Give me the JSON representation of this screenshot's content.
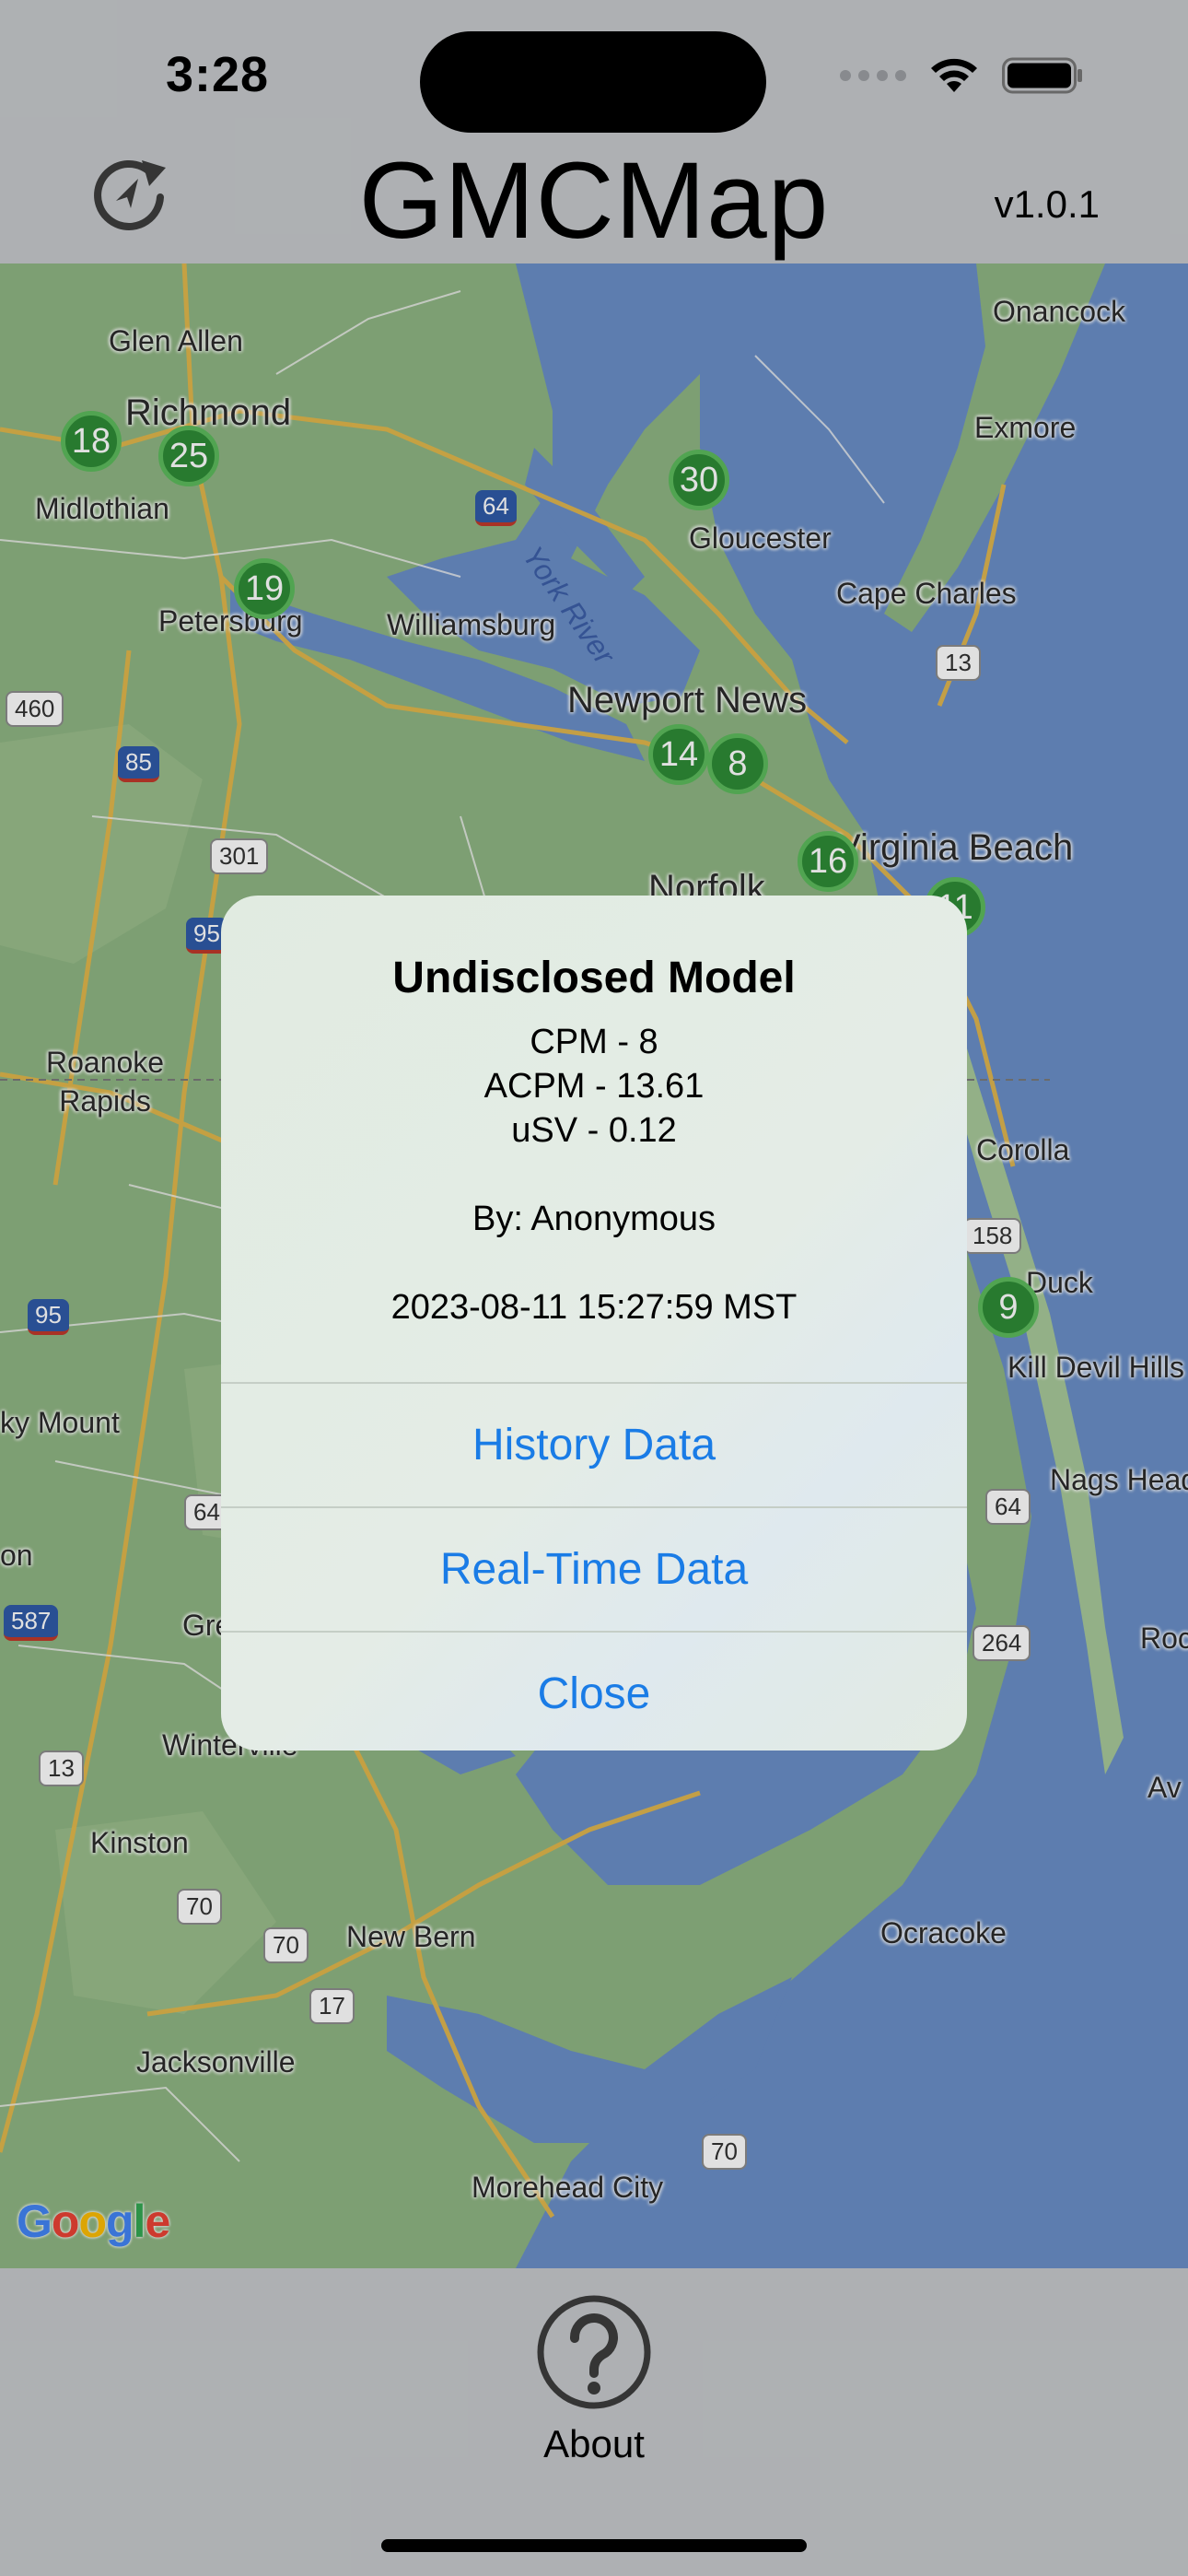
{
  "status_bar": {
    "time": "3:28"
  },
  "header": {
    "title": "GMCMap",
    "version": "v1.0.1",
    "refresh_icon": "refresh-location-icon"
  },
  "map": {
    "attribution": "Google",
    "places": {
      "glen_allen": "Glen Allen",
      "richmond": "Richmond",
      "midlothian": "Midlothian",
      "petersburg": "Petersburg",
      "williamsburg": "Williamsburg",
      "gloucester": "Gloucester",
      "york_river": "York River",
      "onancock": "Onancock",
      "exmore": "Exmore",
      "cape_charles": "Cape Charles",
      "newport_news": "Newport News",
      "virginia_beach": "Virginia Beach",
      "norfolk": "Norfolk",
      "roanoke_rapids": "Roanoke\nRapids",
      "corolla": "Corolla",
      "duck": "Duck",
      "kill_devil_hills": "Kill Devil Hills",
      "nags_head": "Nags Head",
      "rocky_mount": "ky Mount",
      "on": "on",
      "gre": "Gre",
      "winterville": "Winterville",
      "kinston": "Kinston",
      "new_bern": "New Bern",
      "jacksonville": "Jacksonville",
      "morehead_city": "Morehead City",
      "ocracoke": "Ocracoke",
      "roc": "Roc",
      "av": "Av"
    },
    "shields": {
      "i64_a": "64",
      "i85": "85",
      "i95_a": "95",
      "i95_b": "95",
      "i587": "587",
      "r460": "460",
      "r301": "301",
      "r13_a": "13",
      "r13_b": "13",
      "r158": "158",
      "r64_b": "64",
      "r64_c": "64",
      "r264": "264",
      "r70_a": "70",
      "r70_b": "70",
      "r70_c": "70",
      "r17": "17"
    },
    "markers": {
      "m18": "18",
      "m25": "25",
      "m19": "19",
      "m30": "30",
      "m14": "14",
      "m8": "8",
      "m16": "16",
      "m11": "11",
      "m9": "9"
    }
  },
  "alert": {
    "title": "Undisclosed Model",
    "cpm": "CPM - 8",
    "acpm": "ACPM - 13.61",
    "usv": "uSV - 0.12",
    "by": "By: Anonymous",
    "timestamp": "2023-08-11 15:27:59 MST",
    "actions": {
      "history": "History Data",
      "realtime": "Real-Time Data",
      "close": "Close"
    }
  },
  "tab_bar": {
    "about_label": "About",
    "about_icon": "question-mark-circle-icon"
  },
  "colors": {
    "bar_background": "#c6c9cc",
    "water": "#6a8fc8",
    "land": "#8fb583",
    "marker": "#2e8b36",
    "link": "#1a7ce6"
  }
}
